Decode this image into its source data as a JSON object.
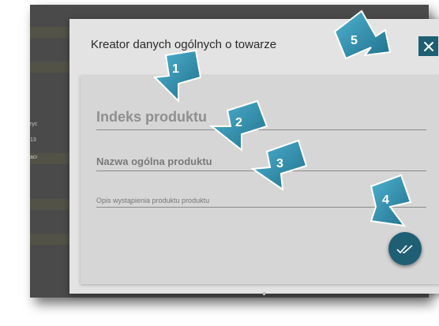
{
  "dialog": {
    "title": "Kreator danych ogólnych o towarze",
    "fields": {
      "product_index": {
        "placeholder": "Indeks produktu",
        "value": ""
      },
      "product_name": {
        "placeholder": "Nazwa ogólna produktu",
        "value": ""
      },
      "product_description": {
        "placeholder": "Opis wystąpienia produktu produktu",
        "value": ""
      }
    }
  },
  "background_fragments": [
    "ryc",
    "13",
    "aci"
  ],
  "callouts": [
    "1",
    "2",
    "3",
    "4",
    "5"
  ],
  "colors": {
    "accent": "#1e5f74",
    "callout_arrow": "#2f8fae",
    "dialog_bg": "#e3e3e3",
    "panel_bg": "#d6d6d6",
    "frame_bg": "#4a4a4a"
  },
  "icons": {
    "close": "close-icon",
    "confirm": "double-check-icon"
  }
}
